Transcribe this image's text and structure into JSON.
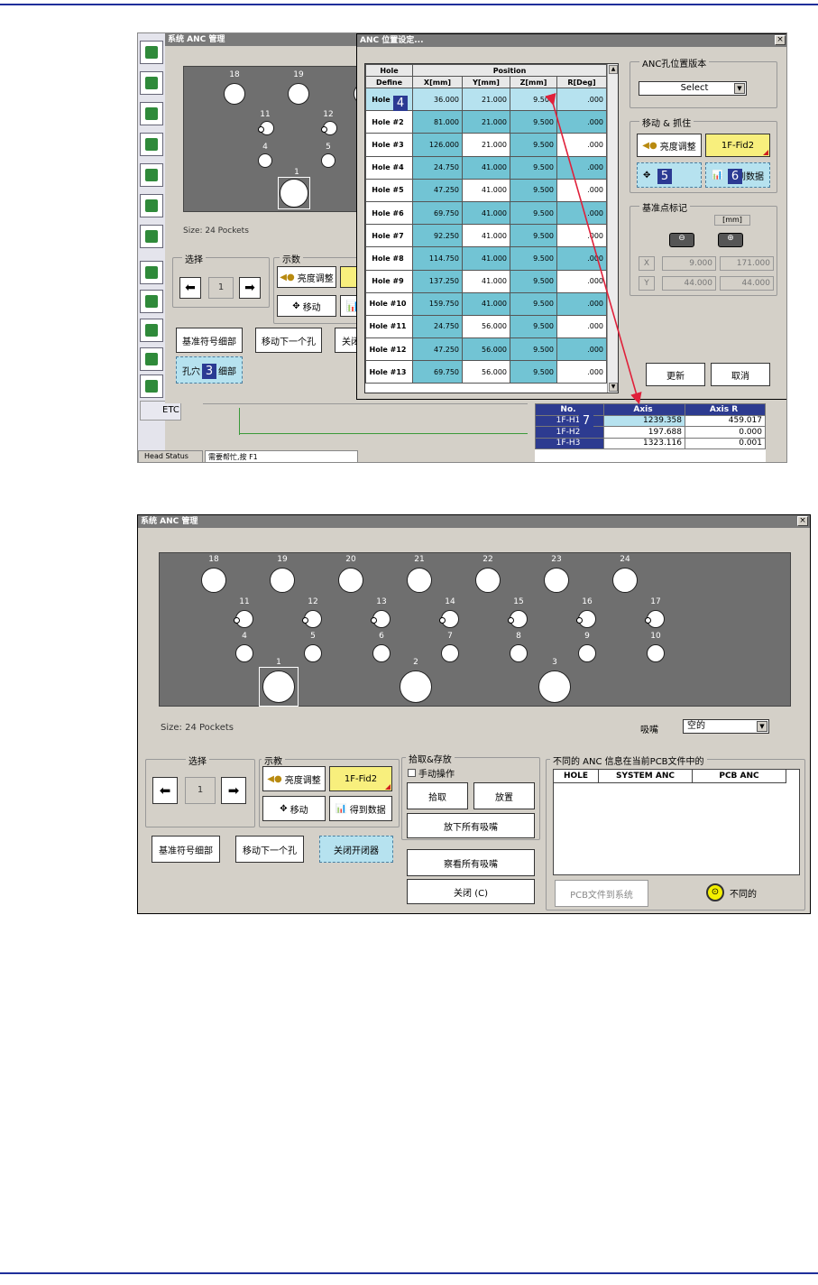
{
  "top_window": {
    "title": "系统 ANC 管理",
    "size_text": "Size: 24 Pockets",
    "select_group": "选择",
    "select_value": "1",
    "teach_group": "示数",
    "brightness": "亮度调整",
    "move": "移动",
    "fiducial_btn": "基准符号细部",
    "next_hole_btn": "移动下一个孔",
    "close_partial": "关闭",
    "hole_detail_btn_a": "孔穴",
    "hole_detail_btn_b": "细部",
    "etc": "ETC",
    "head_status": "Head Status",
    "help_hint": "需要帮忙,按 F1",
    "sidebar_icons": [
      "layout-icon",
      "chip-icon",
      "camera-icon",
      "checklist-icon",
      "inspect-icon",
      "locate-icon",
      "board-icon",
      "robot-icon",
      "home-icon",
      "folder-icon",
      "chart-icon",
      "pcb-icon"
    ]
  },
  "anc_dialog": {
    "title": "ANC 位置设定...",
    "header_hole": "Hole",
    "header_define": "Define",
    "header_position": "Position",
    "columns": [
      "X[mm]",
      "Y[mm]",
      "Z[mm]",
      "R[Deg]"
    ],
    "rows": [
      {
        "hole": "Hole #1",
        "x": "36.000",
        "y": "21.000",
        "z": "9.500",
        "r": ".000"
      },
      {
        "hole": "Hole #2",
        "x": "81.000",
        "y": "21.000",
        "z": "9.500",
        "r": ".000"
      },
      {
        "hole": "Hole #3",
        "x": "126.000",
        "y": "21.000",
        "z": "9.500",
        "r": ".000"
      },
      {
        "hole": "Hole #4",
        "x": "24.750",
        "y": "41.000",
        "z": "9.500",
        "r": ".000"
      },
      {
        "hole": "Hole #5",
        "x": "47.250",
        "y": "41.000",
        "z": "9.500",
        "r": ".000"
      },
      {
        "hole": "Hole #6",
        "x": "69.750",
        "y": "41.000",
        "z": "9.500",
        "r": ".000"
      },
      {
        "hole": "Hole #7",
        "x": "92.250",
        "y": "41.000",
        "z": "9.500",
        "r": ".000"
      },
      {
        "hole": "Hole #8",
        "x": "114.750",
        "y": "41.000",
        "z": "9.500",
        "r": ".000"
      },
      {
        "hole": "Hole #9",
        "x": "137.250",
        "y": "41.000",
        "z": "9.500",
        "r": ".000"
      },
      {
        "hole": "Hole #10",
        "x": "159.750",
        "y": "41.000",
        "z": "9.500",
        "r": ".000"
      },
      {
        "hole": "Hole #11",
        "x": "24.750",
        "y": "56.000",
        "z": "9.500",
        "r": ".000"
      },
      {
        "hole": "Hole #12",
        "x": "47.250",
        "y": "56.000",
        "z": "9.500",
        "r": ".000"
      },
      {
        "hole": "Hole #13",
        "x": "69.750",
        "y": "56.000",
        "z": "9.500",
        "r": ".000"
      }
    ],
    "version_group": "ANC孔位置版本",
    "version_select": "Select",
    "move_group": "移动 & 抓住",
    "brightness": "亮度调整",
    "fid_value": "1F-Fid2",
    "get_data": "得到数据",
    "mark_group": "基准点标记",
    "unit": "[mm]",
    "x_label": "X",
    "y_label": "Y",
    "x1": "9.000",
    "x2": "171.000",
    "y1": "44.000",
    "y2": "44.000",
    "update": "更新",
    "cancel": "取消"
  },
  "axis_table": {
    "headers": [
      "No.",
      "Axis",
      "Axis R"
    ],
    "rows": [
      {
        "no": "1F-H1",
        "axis": "1239.358",
        "r": "459.017"
      },
      {
        "no": "1F-H2",
        "axis": "197.688",
        "r": "0.000"
      },
      {
        "no": "1F-H3",
        "axis": "1323.116",
        "r": "0.001"
      }
    ]
  },
  "callouts": [
    "3",
    "4",
    "5",
    "6",
    "7"
  ],
  "bottom_window": {
    "title": "系统 ANC 管理",
    "holes": [
      "18",
      "19",
      "20",
      "21",
      "22",
      "23",
      "24",
      "11",
      "12",
      "13",
      "14",
      "15",
      "16",
      "17",
      "4",
      "5",
      "6",
      "7",
      "8",
      "9",
      "10",
      "1",
      "2",
      "3"
    ],
    "size_text": "Size: 24 Pockets",
    "nozzle_label": "吸嘴",
    "nozzle_value": "空的",
    "select_group": "选择",
    "select_value": "1",
    "teach_group": "示教",
    "brightness": "亮度调整",
    "fid_value": "1F-Fid2",
    "move": "移动",
    "get_data": "得到数据",
    "fiducial_btn": "基准符号细部",
    "next_hole_btn": "移动下一个孔",
    "close_gripper_btn": "关闭开闭器",
    "pick_group": "拾取&存放",
    "manual_label": "手动操作",
    "pick": "拾取",
    "place": "放置",
    "drop_all": "放下所有吸嘴",
    "view_all": "察看所有吸嘴",
    "close": "关闭 (C)",
    "diff_group": "不同的 ANC 信息在当前PCB文件中的",
    "diff_columns": [
      "HOLE",
      "SYSTEM ANC",
      "PCB ANC"
    ],
    "pcb_to_system": "PCB文件到系统",
    "different_label": "不同的"
  }
}
